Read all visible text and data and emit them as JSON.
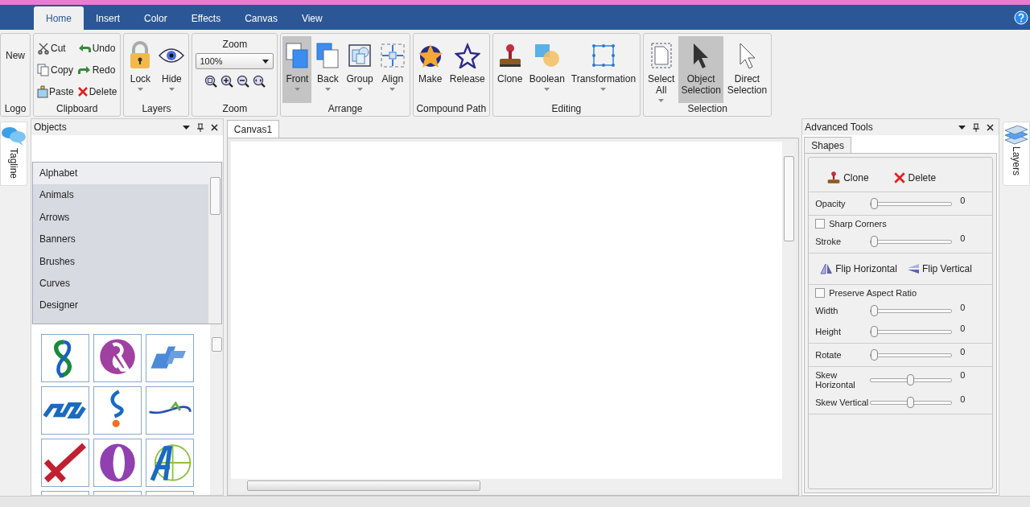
{
  "tabs": [
    {
      "label": "Home",
      "selected": true
    },
    {
      "label": "Insert",
      "selected": false
    },
    {
      "label": "Color",
      "selected": false
    },
    {
      "label": "Effects",
      "selected": false
    },
    {
      "label": "Canvas",
      "selected": false
    },
    {
      "label": "View",
      "selected": false
    }
  ],
  "ribbon": {
    "groups": [
      {
        "label": "Logo",
        "kind": "plain",
        "buttons": [
          {
            "label": "New"
          }
        ]
      },
      {
        "label": "Clipboard",
        "kind": "small",
        "buttons": [
          {
            "label": "Cut"
          },
          {
            "label": "Undo"
          },
          {
            "label": "Copy"
          },
          {
            "label": "Redo"
          },
          {
            "label": "Paste"
          },
          {
            "label": "Delete"
          }
        ]
      },
      {
        "label": "Layers",
        "kind": "large",
        "buttons": [
          {
            "label": "Lock",
            "dropdown": true,
            "selected": false
          },
          {
            "label": "Hide",
            "dropdown": true,
            "selected": false
          }
        ]
      },
      {
        "label": "Zoom",
        "kind": "zoom",
        "title": "Zoom",
        "value": "100%"
      },
      {
        "label": "Arrange",
        "kind": "large",
        "buttons": [
          {
            "label": "Front",
            "dropdown": true,
            "selected": true
          },
          {
            "label": "Back",
            "dropdown": true,
            "selected": false
          },
          {
            "label": "Group",
            "dropdown": true,
            "selected": false
          },
          {
            "label": "Align",
            "dropdown": true,
            "selected": false
          }
        ]
      },
      {
        "label": "Compound Path",
        "kind": "large",
        "buttons": [
          {
            "label": "Make",
            "dropdown": false,
            "selected": false
          },
          {
            "label": "Release",
            "dropdown": false,
            "selected": false
          }
        ]
      },
      {
        "label": "Editing",
        "kind": "large",
        "buttons": [
          {
            "label": "Clone",
            "dropdown": false,
            "selected": false
          },
          {
            "label": "Boolean",
            "dropdown": true,
            "selected": false
          },
          {
            "label": "Transformation",
            "dropdown": true,
            "selected": false
          }
        ]
      },
      {
        "label": "Selection",
        "kind": "large",
        "buttons": [
          {
            "label": "Select All",
            "dropdown": true,
            "selected": false
          },
          {
            "label": "Object Selection",
            "dropdown": false,
            "selected": true
          },
          {
            "label": "Direct Selection",
            "dropdown": false,
            "selected": false
          }
        ]
      }
    ]
  },
  "left_tab": {
    "label": "Tagline"
  },
  "objects_panel": {
    "title": "Objects",
    "categories": [
      {
        "label": "Alphabet",
        "selected": true
      },
      {
        "label": "Animals",
        "selected": false
      },
      {
        "label": "Arrows",
        "selected": false
      },
      {
        "label": "Banners",
        "selected": false
      },
      {
        "label": "Brushes",
        "selected": false
      },
      {
        "label": "Curves",
        "selected": false
      },
      {
        "label": "Designer",
        "selected": false
      }
    ]
  },
  "canvas": {
    "tab": "Canvas1"
  },
  "advanced_tools": {
    "title": "Advanced Tools",
    "tabs": [
      {
        "label": "Shapes",
        "selected": true
      }
    ],
    "sections": [
      {
        "rows": [
          {
            "kind": "buttons",
            "buttons": [
              {
                "label": "Clone"
              },
              {
                "label": "Delete"
              }
            ]
          }
        ]
      },
      {
        "rows": [
          {
            "kind": "slider",
            "label": "Opacity",
            "level": 0,
            "reading": "0"
          }
        ]
      },
      {
        "rows": [
          {
            "kind": "checkbox",
            "label": "Sharp Corners",
            "checked": false
          },
          {
            "kind": "slider",
            "label": "Stroke",
            "level": 0,
            "reading": "0"
          }
        ]
      },
      {
        "rows": [
          {
            "kind": "buttons",
            "buttons": [
              {
                "label": "Flip Horizontal"
              },
              {
                "label": "Flip Vertical"
              }
            ]
          }
        ]
      },
      {
        "rows": [
          {
            "kind": "checkbox",
            "label": "Preserve Aspect Ratio",
            "checked": false
          },
          {
            "kind": "slider",
            "label": "Width",
            "level": 0,
            "reading": "0"
          },
          {
            "kind": "slider",
            "label": "Height",
            "level": 0,
            "reading": "0"
          }
        ]
      },
      {
        "rows": [
          {
            "kind": "slider",
            "label": "Rotate",
            "level": 0,
            "reading": "0"
          }
        ]
      },
      {
        "rows": [
          {
            "kind": "slider",
            "label": "Skew Horizontal",
            "level": 0.5,
            "reading": "0"
          },
          {
            "kind": "slider",
            "label": "Skew Vertical",
            "level": 0.5,
            "reading": "0"
          }
        ]
      }
    ]
  },
  "right_tab": {
    "label": "Layers"
  }
}
